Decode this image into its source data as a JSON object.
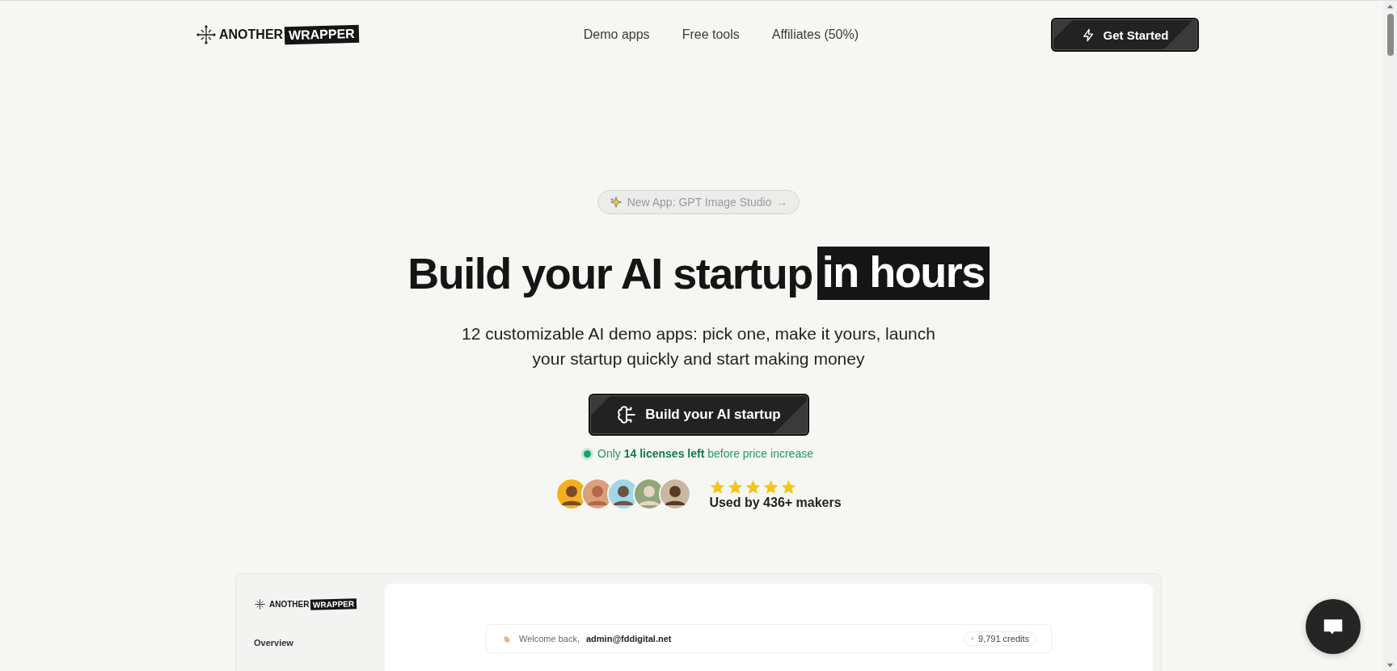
{
  "header": {
    "logo": {
      "word_1": "ANOTHER",
      "word_2": "WRAPPER"
    },
    "nav": [
      "Demo apps",
      "Free tools",
      "Affiliates (50%)"
    ],
    "cta": "Get Started"
  },
  "hero": {
    "badge": "New App: GPT Image Studio",
    "badge_arrow": "→",
    "headline": "Build your AI startup",
    "headline_highlight": "in hours",
    "subtitle": "12 customizable AI demo apps: pick one, make it yours, launch your startup quickly and start making money",
    "cta": "Build your AI startup",
    "availability": "Only **14 licenses left** before price increase",
    "rating": {
      "stars": 5,
      "caption": "Used by 436+ makers"
    }
  },
  "preview": {
    "logo": {
      "word_1": "ANOTHER",
      "word_2": "WRAPPER"
    },
    "sidebar_items": [
      "Overview"
    ],
    "welcome": "Welcome back,",
    "user": "admin@fddigital.net",
    "credits": "9,791 credits"
  }
}
